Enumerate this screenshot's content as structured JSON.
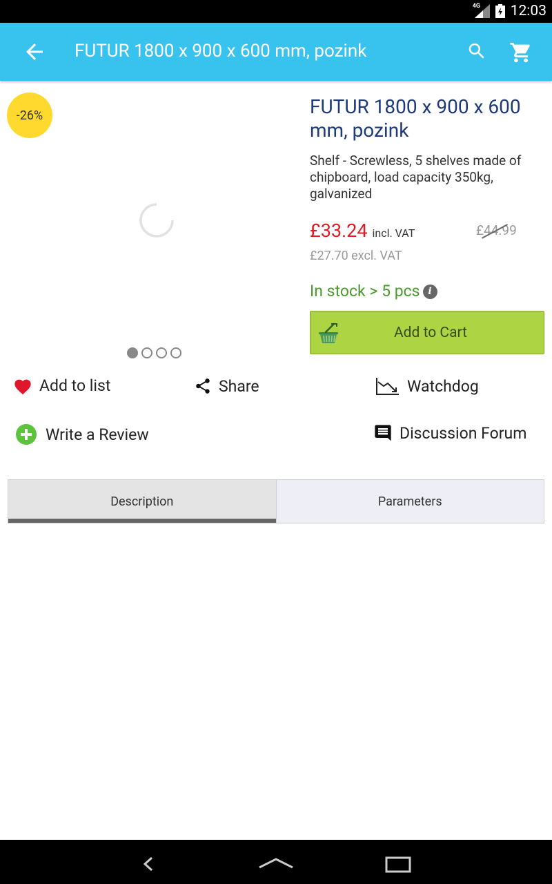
{
  "status_bar": {
    "network": "4G",
    "time": "12:03"
  },
  "app_bar": {
    "title": "FUTUR 1800 x 900 x 600 mm, pozink"
  },
  "product": {
    "discount": "-26%",
    "title": "FUTUR 1800 x 900 x 600 mm, pozink",
    "description": "Shelf - Screwless, 5 shelves made of chipboard, load capacity 350kg, galvanized",
    "price": "£33.24",
    "price_vat_label": "incl. VAT",
    "old_price": "£44.99",
    "price_excl": "£27.70 excl. VAT",
    "stock": "In stock > 5 pcs",
    "add_to_cart": "Add to Cart",
    "image_pages": 4,
    "image_active_page": 1
  },
  "actions": {
    "add_to_list": "Add to list",
    "share": "Share",
    "watchdog": "Watchdog",
    "write_review": "Write a Review",
    "discussion_forum": "Discussion Forum"
  },
  "tabs": [
    {
      "label": "Description",
      "active": true
    },
    {
      "label": "Parameters",
      "active": false
    }
  ],
  "colors": {
    "app_bar": "#38c3ef",
    "badge": "#ffd92e",
    "price": "#e01b24",
    "stock": "#4a9a2e",
    "add_to_cart": "#acd443",
    "heart": "#e0162b",
    "review_plus": "#5cc33a"
  },
  "icons": {
    "back": "arrow-left-icon",
    "search": "search-icon",
    "cart": "shopping-cart-icon",
    "basket": "basket-icon",
    "heart": "heart-icon",
    "share": "share-icon",
    "watchdog": "trend-down-icon",
    "review": "plus-circle-icon",
    "forum": "chat-bubble-icon",
    "info": "info-icon"
  }
}
